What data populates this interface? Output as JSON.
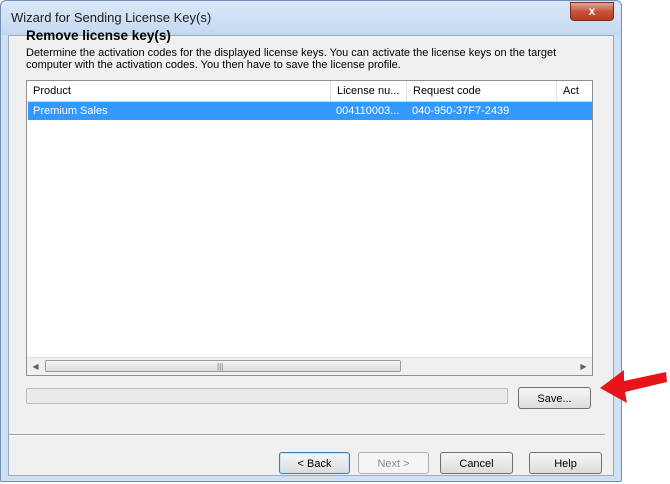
{
  "window": {
    "title": "Wizard for Sending License Key(s)",
    "close_label": "x"
  },
  "page": {
    "heading": "Remove license key(s)",
    "description": "Determine the activation codes for the displayed license keys. You can activate the license keys on the target computer with the activation codes. You then have to save the license profile."
  },
  "list": {
    "columns": [
      "Product",
      "License nu...",
      "Request code",
      "Act"
    ],
    "rows": [
      {
        "product": "Premium Sales",
        "license": "004110003...",
        "request": "040-950-37F7-2439",
        "selected": true
      }
    ],
    "scroll_left": "◀",
    "scroll_right": "▶",
    "scroll_grip": "|||"
  },
  "progress": {
    "value": 0
  },
  "buttons": {
    "save": "Save...",
    "back": "< Back",
    "next": "Next >",
    "cancel": "Cancel",
    "help": "Help"
  },
  "colors": {
    "selection": "#3399ff",
    "annotation_arrow": "#e8141c"
  }
}
